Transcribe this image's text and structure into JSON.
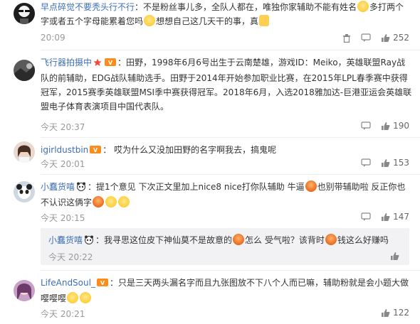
{
  "comments": [
    {
      "username": "早点碎觉不要秃头行不行",
      "text_a": "：不是粉丝事儿多，全队人都在，唯独你家辅助不能有姓名",
      "text_b": "多打两个字或者五个字母能累着您吗",
      "text_c": "想想自己这几天干的事，真",
      "time": "20:09",
      "likes": "252"
    },
    {
      "username": "飞行器拍摄中",
      "text": "：田野，1998年6月6号出生于云南楚雄，游戏ID：Meiko，英雄联盟Ray战队的前辅助，EDG战队辅助选手。田野于2014年开始参加职业比赛，在2015年LPL春季赛中获得冠军，2015赛季英雄联盟MSI季中赛获得冠军。2018年6月，入选2018雅加达-巨港亚运会英雄联盟电子体育表演项目中国代表队。",
      "time": "今天 20:37",
      "likes": "190"
    },
    {
      "username": "igirldustbin",
      "text": "：  哎为什么又没加田野的名字啊我去，搞鬼呢",
      "time": "今天 20:01",
      "likes": "153"
    },
    {
      "username": "小蠢货嘻",
      "text_a": "：提1个意见 下次正文里加上nice8 nice打你队辅助 牛逼",
      "text_b": "也别带辅助啦 反正你也不认识这俩字",
      "time": "今天 20:15",
      "likes": "147"
    },
    {
      "username": "LifeAndSoul_",
      "text": "：只是三天两头漏名字而且九张图放不下八个人而已嘛，辅助粉就是会小题大做嘤嘤嘤",
      "time": "今天 20:21",
      "likes": "122"
    }
  ],
  "reply": {
    "username": "小蠢货嘻",
    "text_a": "：我寻思这位皮下神仙莫不是故意的",
    "text_b": "怎么 受气啦？该背时",
    "text_c": "钱这么好赚吗",
    "time": "今天 20:22"
  },
  "watermark": "..."
}
